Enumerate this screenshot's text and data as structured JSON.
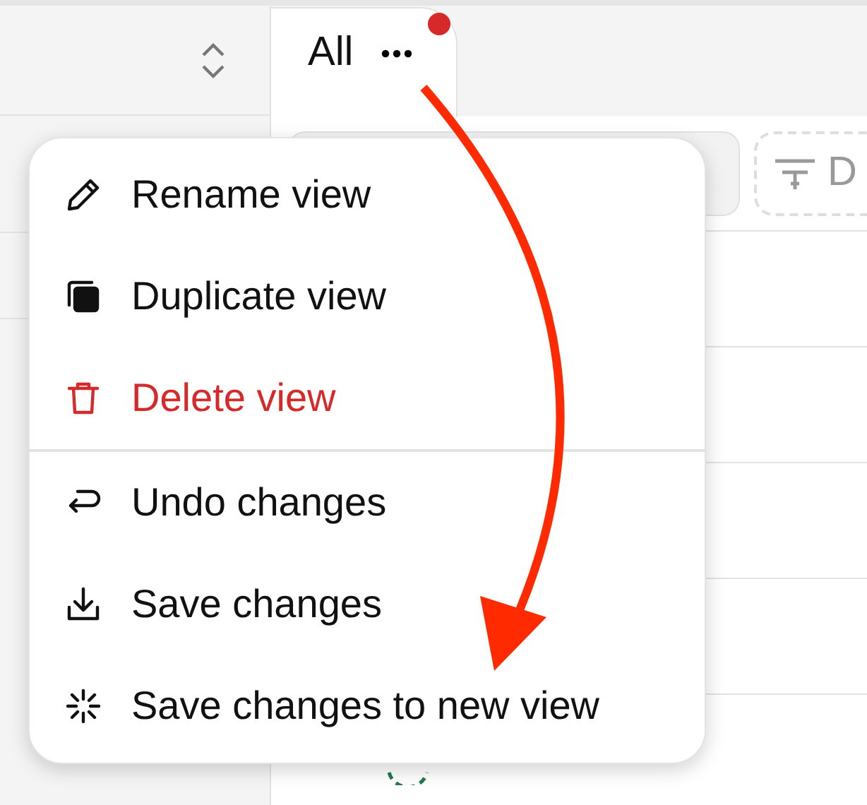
{
  "tabs": [
    {
      "label": "All",
      "selected": true,
      "unsaved": true
    }
  ],
  "filter_button": {
    "label": "D"
  },
  "menu": {
    "sections": [
      [
        {
          "label": "Rename view",
          "kind": "default"
        },
        {
          "label": "Duplicate view",
          "kind": "default"
        },
        {
          "label": "Delete view",
          "kind": "danger"
        }
      ],
      [
        {
          "label": "Undo changes",
          "kind": "default"
        },
        {
          "label": "Save changes",
          "kind": "default"
        },
        {
          "label": "Save changes to new view",
          "kind": "default"
        }
      ]
    ]
  }
}
